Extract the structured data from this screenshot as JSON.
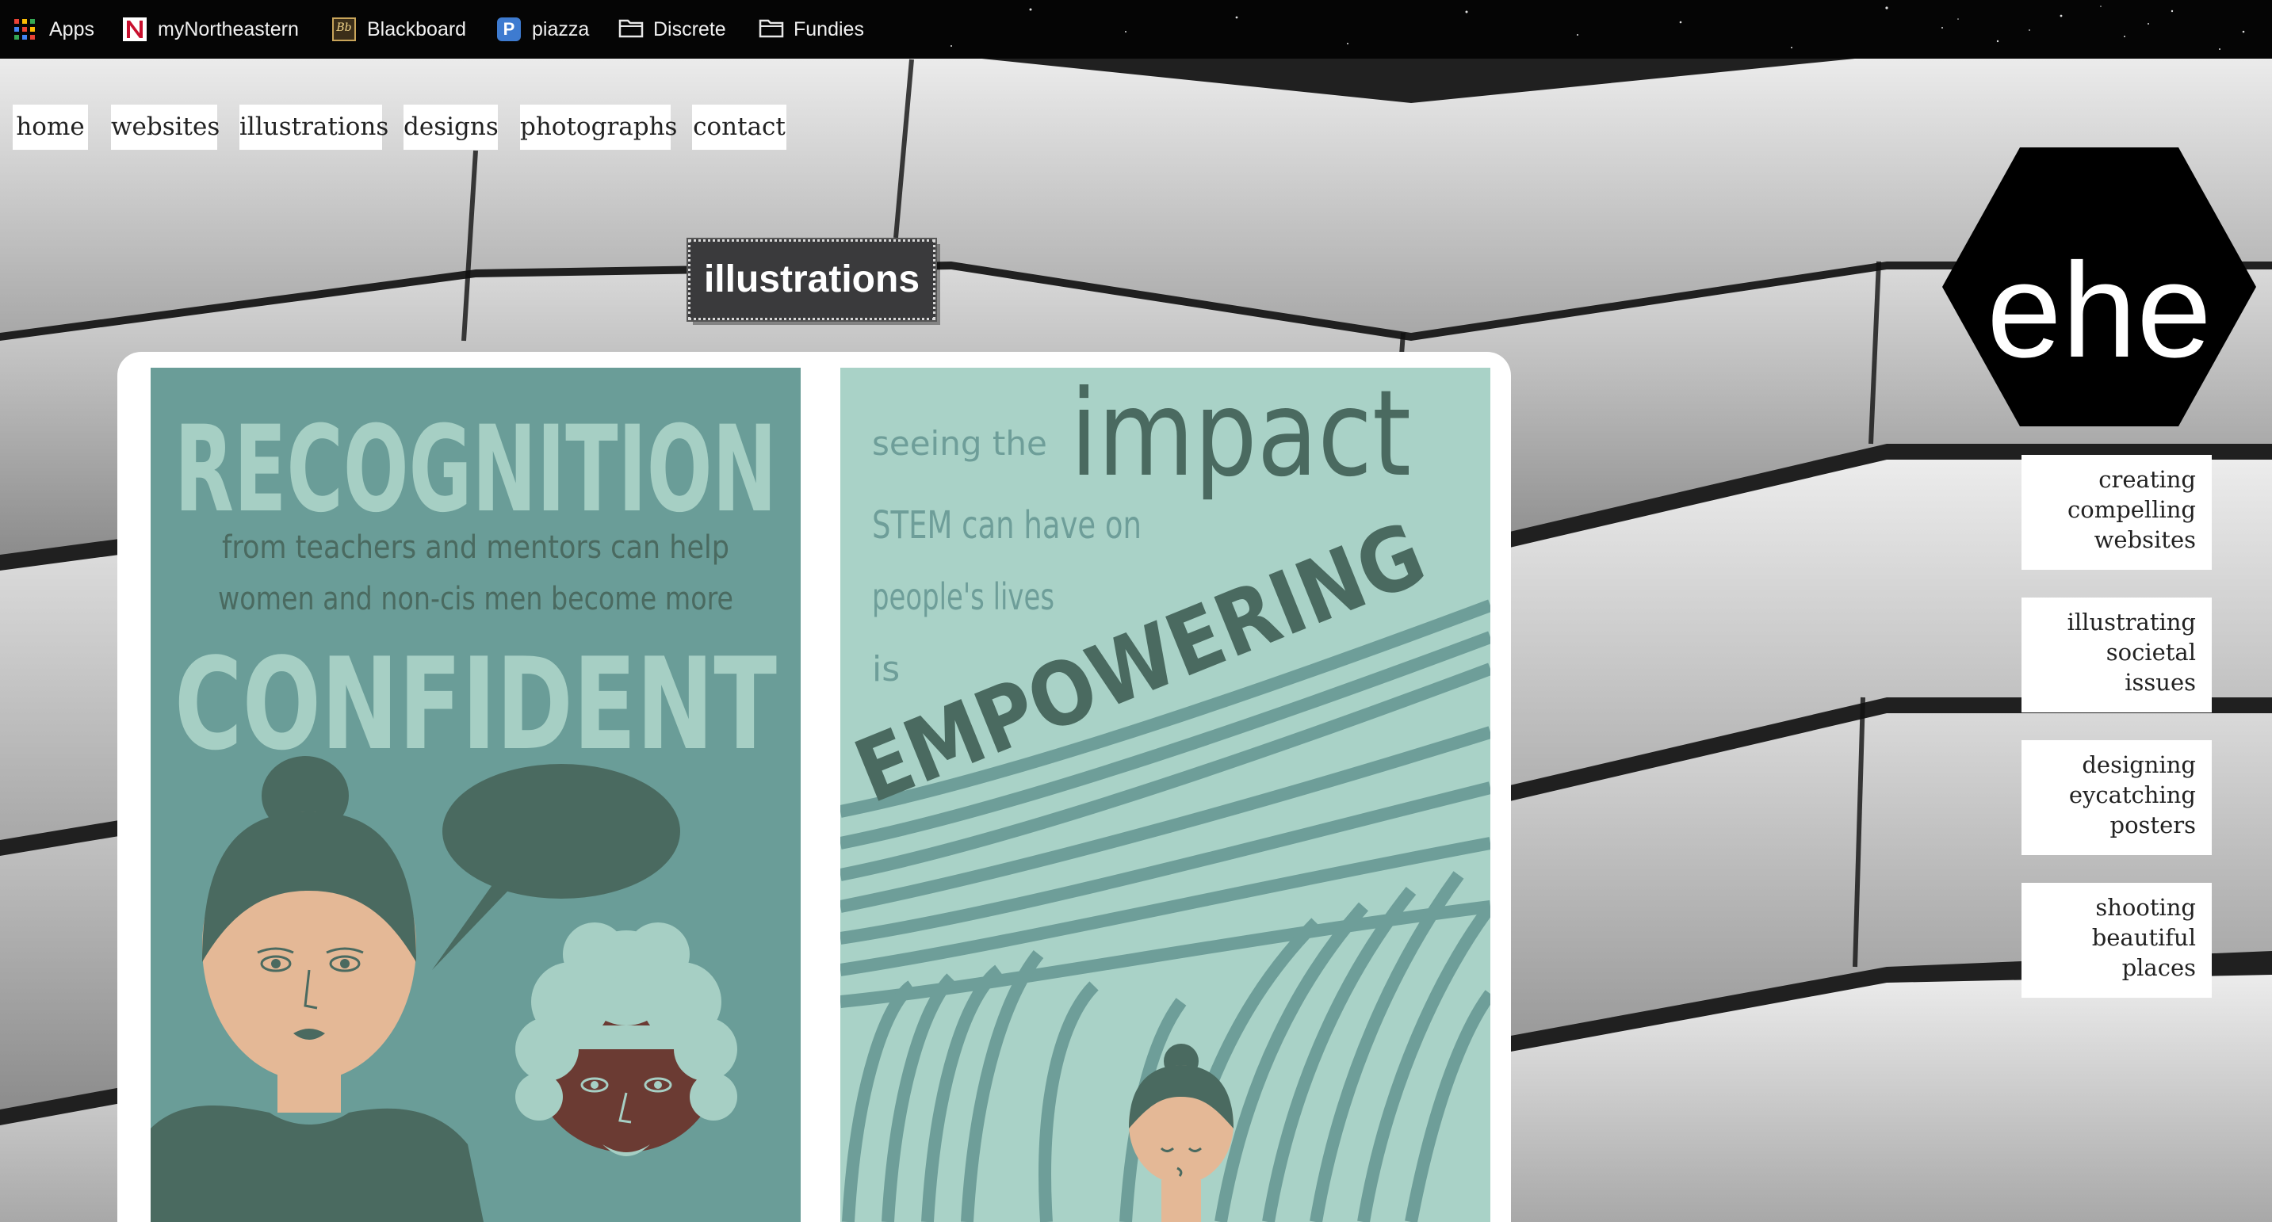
{
  "bookmarks": [
    {
      "label": "Apps",
      "icon": "apps-grid-icon"
    },
    {
      "label": "myNortheastern",
      "icon": "northeastern-n-icon"
    },
    {
      "label": "Blackboard",
      "icon": "blackboard-bb-icon"
    },
    {
      "label": "piazza",
      "icon": "piazza-p-icon"
    },
    {
      "label": "Discrete",
      "icon": "folder-icon"
    },
    {
      "label": "Fundies",
      "icon": "folder-icon"
    }
  ],
  "nav": [
    "home",
    "websites",
    "illustrations",
    "designs",
    "photographs",
    "contact"
  ],
  "page_title": "illustrations",
  "logo_text": "ehe",
  "side_cards": [
    {
      "lines": [
        "creating",
        "compelling",
        "websites"
      ]
    },
    {
      "lines": [
        "illustrating",
        "societal",
        "issues"
      ]
    },
    {
      "lines": [
        "designing",
        "eycatching",
        "posters"
      ]
    },
    {
      "lines": [
        "shooting",
        "beautiful",
        "places"
      ]
    }
  ],
  "posters": {
    "recognition": {
      "headline_top": "RECOGNITION",
      "line1": "from teachers and mentors can help",
      "line2": "women and non-cis men become more",
      "headline_bottom": "CONFIDENT"
    },
    "impact": {
      "line_seeing": "seeing the",
      "word_impact": "impact",
      "line_stem": "STEM can have on",
      "line_people": "people's lives",
      "line_is": "is",
      "word_empowering": "EMPOWERING"
    }
  },
  "colors": {
    "poster1_bg": "#6a9d98",
    "poster1_text": "#a6cfc4",
    "poster1_dark": "#4a6a60",
    "poster2_bg": "#a9d2c7",
    "poster2_stripe": "#6e9e99",
    "poster2_dark": "#4a6a60",
    "skin_light": "#e4b896",
    "skin_dark": "#6b3b33"
  }
}
